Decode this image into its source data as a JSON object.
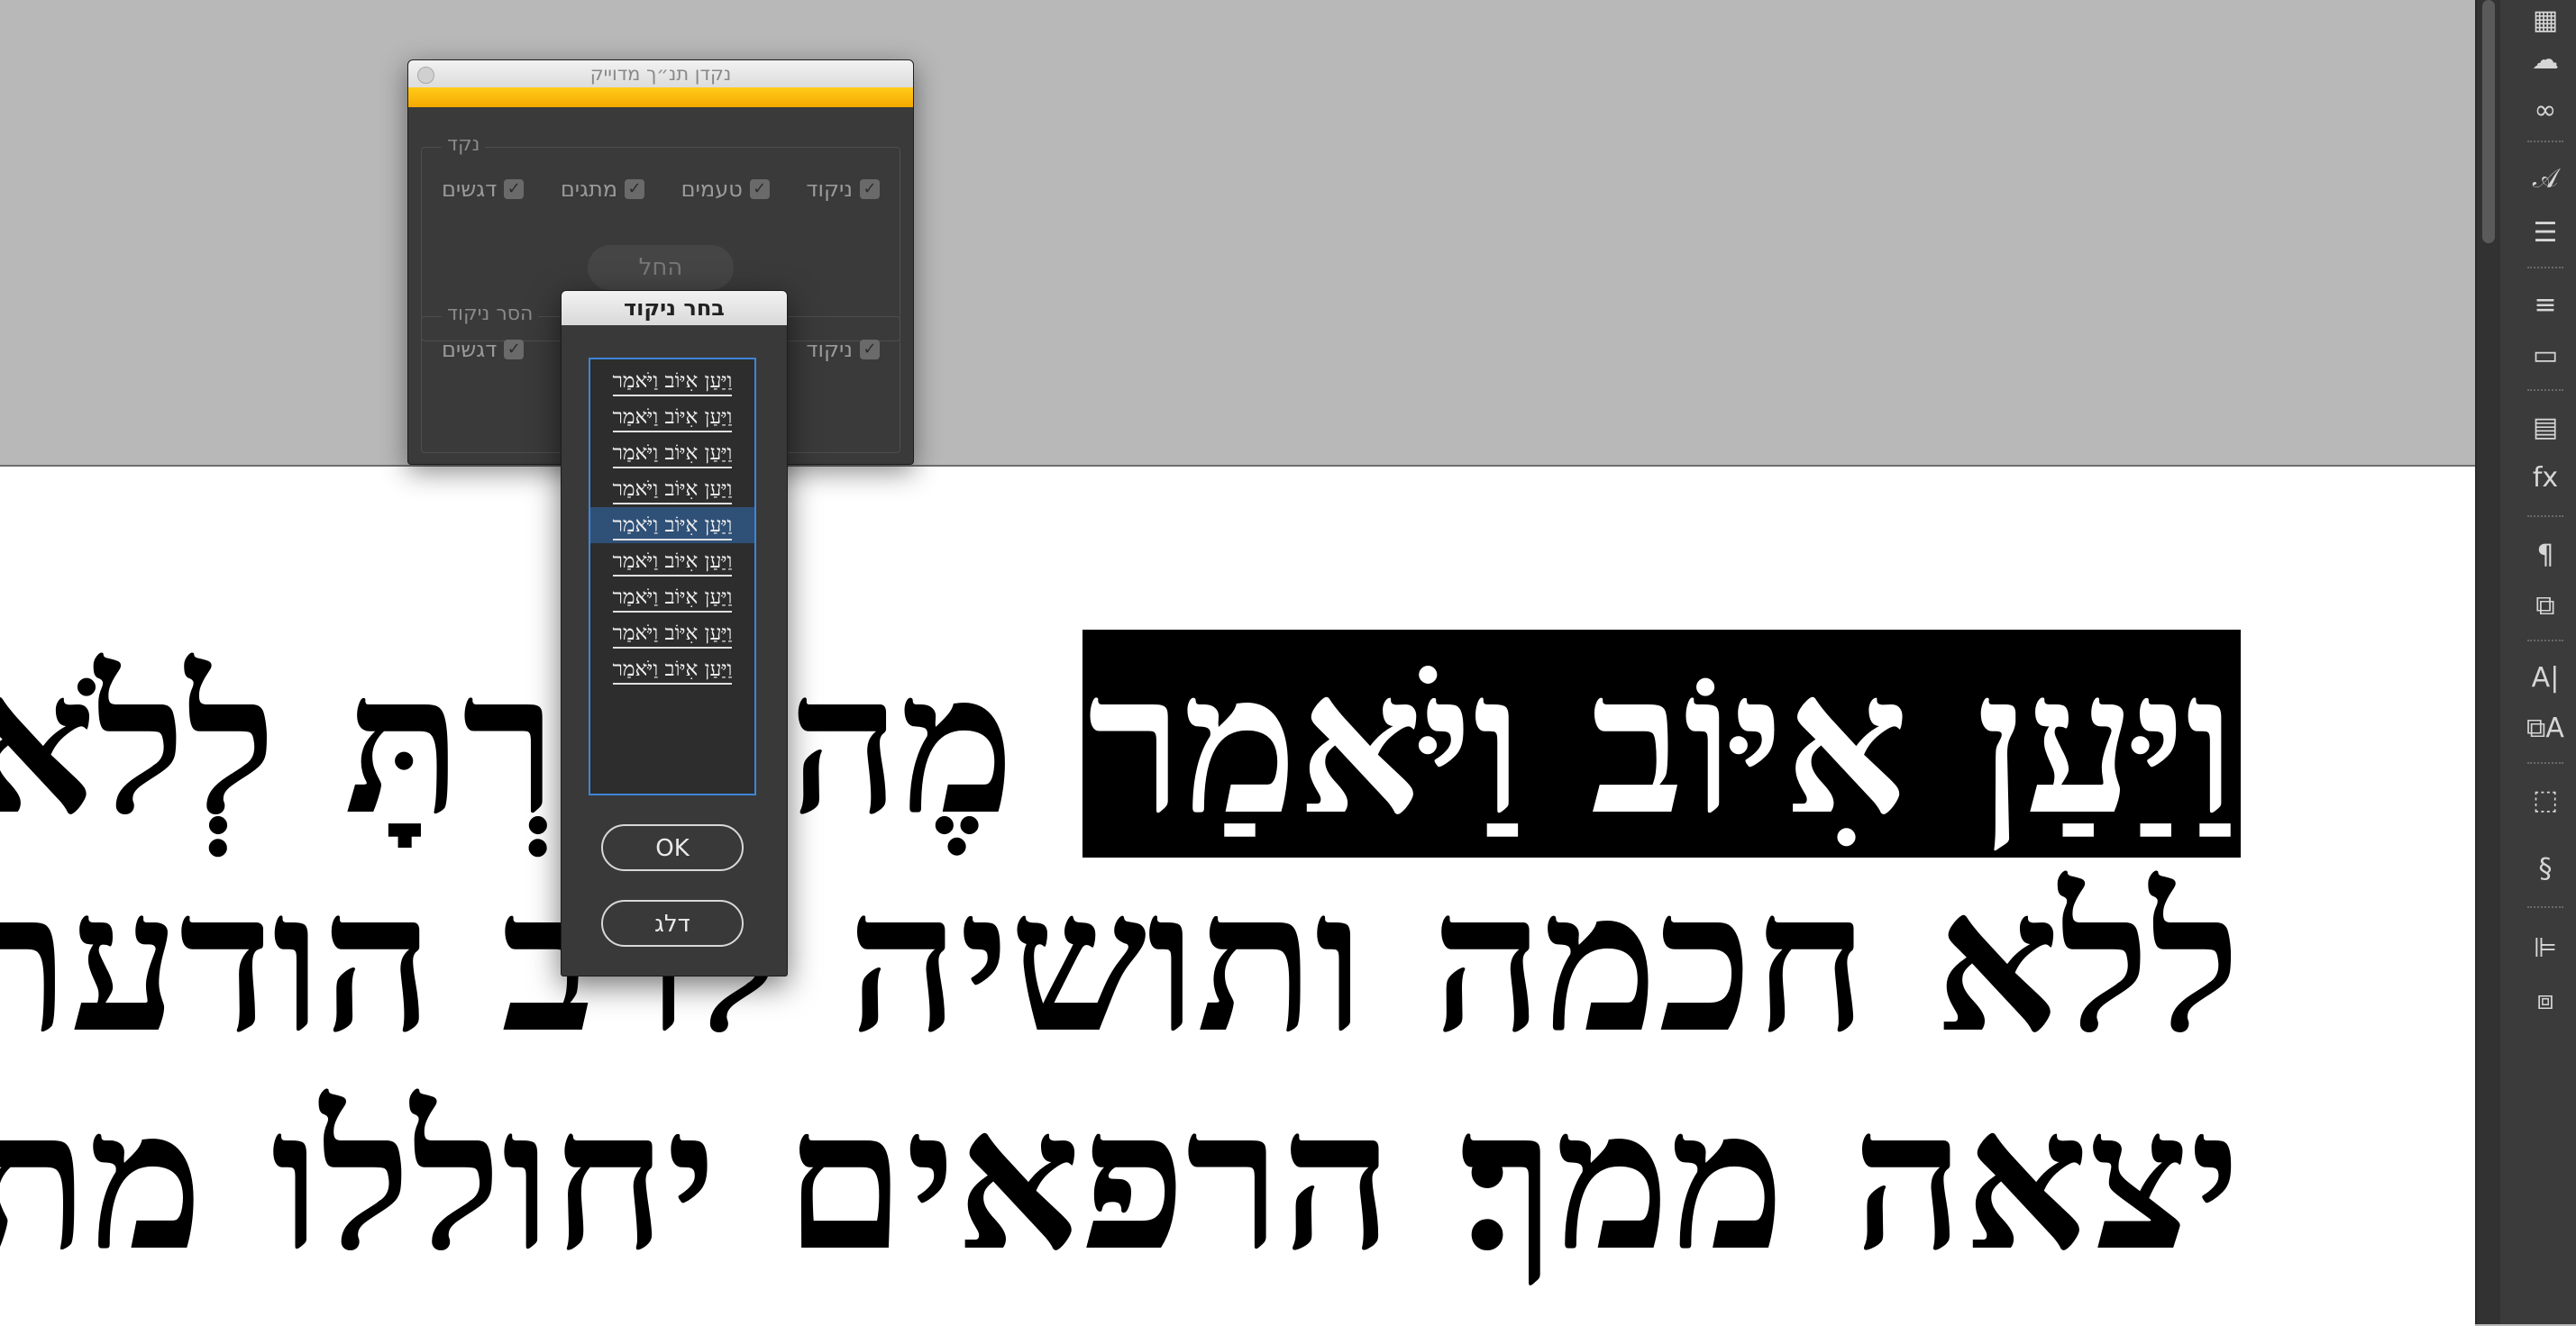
{
  "document": {
    "line1": {
      "highlighted": "וַיַּעַן אִיּוֹב וַיֹּאמַר",
      "rest": "׃ מֶה עָזַרְתָּ לְלֹא כֹחַ הוֹ"
    },
    "line2": "ללא חכמה ותושיה לרב הודעת׃ את",
    "line3": "יצאה ממך׃ הרפאים יחוללו מתחת מ"
  },
  "nikud_dialog": {
    "title": "נקדן תנ״ך מדוייק",
    "add_group": {
      "legend": "נקד",
      "checkboxes": [
        "דגשים",
        "מתגים",
        "טעמים",
        "ניקוד"
      ],
      "start_button": "החל"
    },
    "remove_group": {
      "legend": "הסר ניקוד",
      "checkboxes": [
        "דגשים",
        "ניקוד"
      ]
    }
  },
  "choose_dialog": {
    "title": "בחר ניקוד",
    "options": [
      "וַיַּעַן אִיּוֹב וַיֹּאמַר",
      "וַיַּעַן אִיּוֹב וַיֹּאמַר",
      "וַיַּעַן אִיּוֹב וַיֹּאמַר",
      "וַיַּעַן אִיּוֹב וַיֹּאמַר",
      "וַיַּעַן אִיּוֹב וַיֹּאמַר",
      "וַיַּעַן אִיּוֹב וַיֹּאמַר",
      "וַיַּעַן אִיּוֹב וַיֹּאמַר",
      "וַיַּעַן אִיּוֹב וַיֹּאמַר",
      "וַיַּעַן אִיּוֹב וַיֹּאמַר"
    ],
    "selected_index": 4,
    "ok_label": "OK",
    "skip_label": "דלג"
  },
  "panel_tools": [
    {
      "name": "swatches-icon",
      "glyph": "▦"
    },
    {
      "name": "creative-cloud-icon",
      "glyph": "☁"
    },
    {
      "name": "links-icon",
      "glyph": "∞"
    },
    {
      "name": "character-styles-icon",
      "glyph": "𝒜"
    },
    {
      "name": "text-wrap-icon",
      "glyph": "☰"
    },
    {
      "name": "stroke-icon",
      "glyph": "≡"
    },
    {
      "name": "gradient-icon",
      "glyph": "▭"
    },
    {
      "name": "pages-icon",
      "glyph": "▤"
    },
    {
      "name": "effects-icon",
      "glyph": "fx"
    },
    {
      "name": "paragraph-icon",
      "glyph": "¶"
    },
    {
      "name": "paragraph-styles-icon",
      "glyph": "⧉"
    },
    {
      "name": "character-icon",
      "glyph": "A|"
    },
    {
      "name": "character-styles-alt-icon",
      "glyph": "⧉A"
    },
    {
      "name": "object-styles-icon",
      "glyph": "⬚"
    },
    {
      "name": "scripts-icon",
      "glyph": "§"
    },
    {
      "name": "align-icon",
      "glyph": "⊫"
    },
    {
      "name": "pathfinder-icon",
      "glyph": "⧈"
    }
  ]
}
